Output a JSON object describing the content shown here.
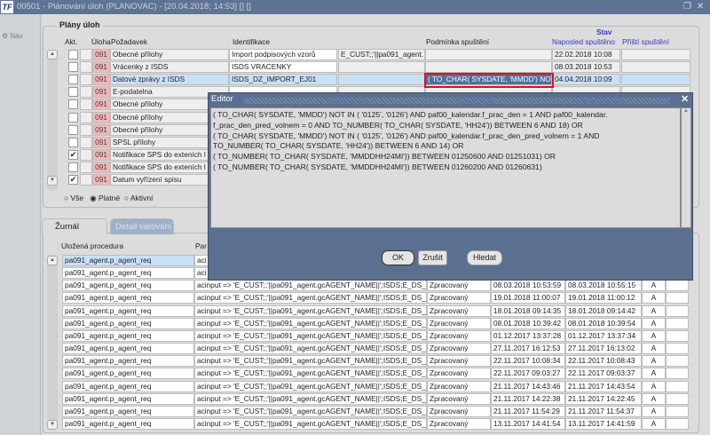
{
  "window": {
    "title": "00501 - Plánování úloh (PLANOVAC) - [20.04.2018; 14:53] [] []",
    "logo": "TF"
  },
  "nav": {
    "label": "Nav"
  },
  "plany": {
    "group_title": "Plány úloh",
    "headers": {
      "akt": "Akt.",
      "uloha": "Úloha",
      "pozadavek": "Požadavek",
      "identifikace": "Identifikace",
      "podminka": "Podmínka spuštění",
      "stav": "Stav",
      "naposled": "Naposled spuštěno",
      "pristi": "Příští spuštění"
    },
    "rows": [
      {
        "checked": false,
        "uloha": "091",
        "pozadavek": "Obecné přílohy",
        "identifikace": "Import podpisových vzorů",
        "param": "E_CUST;;'||pa091_agent.",
        "podminka": "",
        "naposled": "22.02.2018 10:08",
        "pristi": ""
      },
      {
        "checked": false,
        "uloha": "091",
        "pozadavek": "Vrácenky z ISDS",
        "identifikace": "ISDS VRACENKY",
        "param": "",
        "podminka": "",
        "naposled": "08.03.2018 10:53",
        "pristi": ""
      },
      {
        "checked": false,
        "uloha": "091",
        "pozadavek": "Datové zprávy z ISDS",
        "identifikace": "ISDS_DZ_IMPORT_EJ01",
        "param": "",
        "podminka": "( TO_CHAR( SYSDATE, 'MMDD') NO",
        "naposled": "04.04.2018 10:09",
        "pristi": "",
        "selected": true
      },
      {
        "checked": false,
        "uloha": "091",
        "pozadavek": "E-podatelna",
        "identifikace": "",
        "param": "",
        "podminka": "",
        "naposled": "",
        "pristi": ""
      },
      {
        "checked": false,
        "uloha": "091",
        "pozadavek": "Obecné přílohy",
        "identifikace": "",
        "param": "",
        "podminka": "",
        "naposled": "",
        "pristi": ""
      },
      {
        "checked": false,
        "uloha": "091",
        "pozadavek": "Obecné přílohy",
        "identifikace": "",
        "param": "",
        "podminka": "",
        "naposled": "",
        "pristi": ""
      },
      {
        "checked": false,
        "uloha": "091",
        "pozadavek": "Obecné přílohy",
        "identifikace": "",
        "param": "",
        "podminka": "",
        "naposled": "",
        "pristi": ""
      },
      {
        "checked": false,
        "uloha": "091",
        "pozadavek": "SPSL přílohy",
        "identifikace": "",
        "param": "",
        "podminka": "",
        "naposled": "",
        "pristi": ""
      },
      {
        "checked": true,
        "uloha": "091",
        "pozadavek": "Notifikace SPS do exteních l",
        "identifikace": "",
        "param": "",
        "podminka": "",
        "naposled": "",
        "pristi": ""
      },
      {
        "checked": false,
        "uloha": "091",
        "pozadavek": "Notifikace SPS do exteních l",
        "identifikace": "",
        "param": "",
        "podminka": "",
        "naposled": "",
        "pristi": ""
      },
      {
        "checked": true,
        "uloha": "091",
        "pozadavek": "Datum vyřízení spisu",
        "identifikace": "",
        "param": "",
        "podminka": "",
        "naposled": "",
        "pristi": ""
      }
    ],
    "filter": {
      "options": [
        "Vše",
        "Platné",
        "Aktivní"
      ],
      "selected": "Platné"
    }
  },
  "tabs": {
    "zurnal": "Žurnál",
    "detail": "Detail varování",
    "active": "Žurnál"
  },
  "zurnal": {
    "headers": {
      "procedura": "Uložená procedura",
      "param": "Par"
    },
    "rows": [
      {
        "proc": "pa091_agent.p_agent_req",
        "param": "aci",
        "status": "",
        "start": "",
        "end": "",
        "flag": ""
      },
      {
        "proc": "pa091_agent.p_agent_req",
        "param": "aci",
        "status": "",
        "start": "",
        "end": "",
        "flag": ""
      },
      {
        "proc": "pa091_agent.p_agent_req",
        "param": "acinput => 'E_CUST;;'||pa091_agent.gcAGENT_NAME||';ISDS;E_DS_E",
        "status": "Zpracovaný",
        "start": "08.03.2018 10:53:59",
        "end": "08.03.2018 10:55:15",
        "flag": "A"
      },
      {
        "proc": "pa091_agent.p_agent_req",
        "param": "acinput => 'E_CUST;;'||pa091_agent.gcAGENT_NAME||';ISDS;E_DS_E",
        "status": "Zpracovaný",
        "start": "19.01.2018 11:00:07",
        "end": "19.01.2018 11:00:12",
        "flag": "A"
      },
      {
        "proc": "pa091_agent.p_agent_req",
        "param": "acinput => 'E_CUST;;'||pa091_agent.gcAGENT_NAME||';ISDS;E_DS_E",
        "status": "Zpracovaný",
        "start": "18.01.2018 09:14:35",
        "end": "18.01.2018 09:14:42",
        "flag": "A"
      },
      {
        "proc": "pa091_agent.p_agent_req",
        "param": "acinput => 'E_CUST;;'||pa091_agent.gcAGENT_NAME||';ISDS;E_DS_E",
        "status": "Zpracovaný",
        "start": "08.01.2018 10:39:42",
        "end": "08.01.2018 10:39:54",
        "flag": "A"
      },
      {
        "proc": "pa091_agent.p_agent_req",
        "param": "acinput => 'E_CUST;;'||pa091_agent.gcAGENT_NAME||';ISDS;E_DS_E",
        "status": "Zpracovaný",
        "start": "01.12.2017 13:37:28",
        "end": "01.12.2017 13:37:34",
        "flag": "A"
      },
      {
        "proc": "pa091_agent.p_agent_req",
        "param": "acinput => 'E_CUST;;'||pa091_agent.gcAGENT_NAME||';ISDS;E_DS_E",
        "status": "Zpracovaný",
        "start": "27.11.2017 16:12:53",
        "end": "27.11.2017 16:13:02",
        "flag": "A"
      },
      {
        "proc": "pa091_agent.p_agent_req",
        "param": "acinput => 'E_CUST;;'||pa091_agent.gcAGENT_NAME||';ISDS;E_DS_E",
        "status": "Zpracovaný",
        "start": "22.11.2017 10:08:34",
        "end": "22.11.2017 10:08:43",
        "flag": "A"
      },
      {
        "proc": "pa091_agent.p_agent_req",
        "param": "acinput => 'E_CUST;;'||pa091_agent.gcAGENT_NAME||';ISDS;E_DS_E",
        "status": "Zpracovaný",
        "start": "22.11.2017 09:03:27",
        "end": "22.11.2017 09:03:37",
        "flag": "A"
      },
      {
        "proc": "pa091_agent.p_agent_req",
        "param": "acinput => 'E_CUST;;'||pa091_agent.gcAGENT_NAME||';ISDS;E_DS_E",
        "status": "Zpracovaný",
        "start": "21.11.2017 14:43:46",
        "end": "21.11.2017 14:43:54",
        "flag": "A"
      },
      {
        "proc": "pa091_agent.p_agent_req",
        "param": "acinput => 'E_CUST;;'||pa091_agent.gcAGENT_NAME||';ISDS;E_DS_E",
        "status": "Zpracovaný",
        "start": "21.11.2017 14:22:38",
        "end": "21.11.2017 14:22:45",
        "flag": "A"
      },
      {
        "proc": "pa091_agent.p_agent_req",
        "param": "acinput => 'E_CUST;;'||pa091_agent.gcAGENT_NAME||';ISDS;E_DS_E",
        "status": "Zpracovaný",
        "start": "21.11.2017 11:54:29",
        "end": "21.11.2017 11:54:37",
        "flag": "A"
      },
      {
        "proc": "pa091_agent.p_agent_req",
        "param": "acinput => 'E_CUST;;'||pa091_agent.gcAGENT_NAME||';ISDS;E_DS_E",
        "status": "Zpracovaný",
        "start": "13.11.2017 14:41:54",
        "end": "13.11.2017 14:41:59",
        "flag": "A"
      }
    ]
  },
  "editor": {
    "title": "Editor",
    "text": "( TO_CHAR( SYSDATE, 'MMDD') NOT IN ( '0125', '0126') AND paf00_kalendar.f_prac_den = 1 AND paf00_kalendar.\nf_prac_den_pred_volnem = 0 AND TO_NUMBER( TO_CHAR( SYSDATE, 'HH24')) BETWEEN 6 AND 18) OR\n( TO_CHAR( SYSDATE, 'MMDD') NOT IN ( '0125', '0126') AND paf00_kalendar.f_prac_den_pred_volnem = 1 AND\nTO_NUMBER( TO_CHAR( SYSDATE, 'HH24')) BETWEEN 6 AND 14) OR\n( TO_NUMBER( TO_CHAR( SYSDATE, 'MMDDHH24MI')) BETWEEN 01250600 AND 01251031) OR\n( TO_NUMBER( TO_CHAR( SYSDATE, 'MMDDHH24MI')) BETWEEN 01260200 AND 01260631)",
    "ok": "OK",
    "cancel": "Zrušit",
    "find": "Hledat"
  },
  "colors": {
    "titlebar": "#5f7393",
    "editor": "#5b7090",
    "highlight": "#e01010",
    "selected_row": "#c9e1f7",
    "task_badge": "#f6b6b6"
  }
}
